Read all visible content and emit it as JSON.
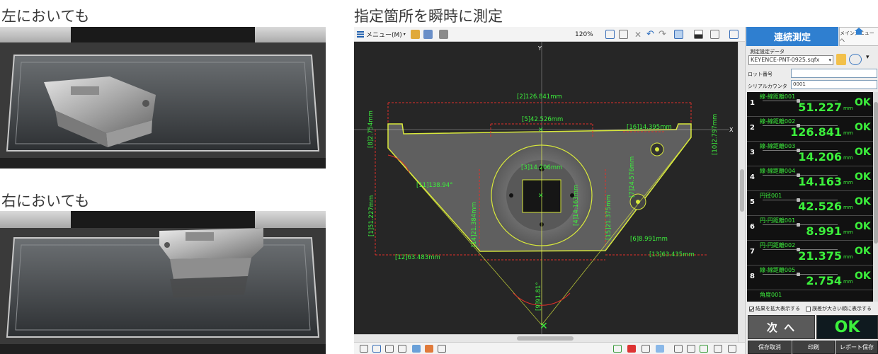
{
  "headings": {
    "left": "左においても",
    "right": "右においても",
    "main": "指定箇所を瞬時に測定"
  },
  "toolbar": {
    "menu_label": "メニュー(M)",
    "zoom": "120%",
    "axis_x": "X",
    "axis_y": "Y"
  },
  "annotations": [
    {
      "label": "[2]126.841mm"
    },
    {
      "label": "[5]42.526mm"
    },
    {
      "label": "[16]14.395mm"
    },
    {
      "label": "[8]2.754mm"
    },
    {
      "label": "[10]2.797mm"
    },
    {
      "label": "[3]14.206mm"
    },
    {
      "label": "[11]138.94°"
    },
    {
      "label": "[1]51.227mm"
    },
    {
      "label": "[14]21.384mm"
    },
    {
      "label": "[4]14.163mm"
    },
    {
      "label": "[15]21.375mm"
    },
    {
      "label": "[7]24.576mm"
    },
    {
      "label": "[6]8.991mm"
    },
    {
      "label": "[12]63.483mm"
    },
    {
      "label": "[13]63.435mm"
    },
    {
      "label": "[9]91.81°"
    }
  ],
  "panel": {
    "mode_title": "連続測定",
    "main_menu": "メインメニューへ",
    "setting_label": "測定設定データ",
    "setting_file": "KEYENCE-PNT-0925.sqfx",
    "lot_label": "ロット番号",
    "lot_value": "",
    "serial_label": "シリアルカウンタ",
    "serial_value": "0001",
    "unit": "mm",
    "results": [
      {
        "index": "1",
        "name": "線-線距離001",
        "value": "51.227",
        "judge": "OK"
      },
      {
        "index": "2",
        "name": "線-線距離002",
        "value": "126.841",
        "judge": "OK"
      },
      {
        "index": "3",
        "name": "線-線距離003",
        "value": "14.206",
        "judge": "OK"
      },
      {
        "index": "4",
        "name": "線-線距離004",
        "value": "14.163",
        "judge": "OK"
      },
      {
        "index": "5",
        "name": "円径001",
        "value": "42.526",
        "judge": "OK"
      },
      {
        "index": "6",
        "name": "円-円距離001",
        "value": "8.991",
        "judge": "OK"
      },
      {
        "index": "7",
        "name": "円-円距離002",
        "value": "21.375",
        "judge": "OK"
      },
      {
        "index": "8",
        "name": "線-線距離005",
        "value": "2.754",
        "judge": "OK"
      },
      {
        "index": "",
        "name": "角度001",
        "value": "",
        "judge": ""
      }
    ],
    "option_enlarge": "結果を拡大表示する",
    "option_sort": "誤差が大きい順に表示する",
    "next_button": "次 へ",
    "overall_judge": "OK",
    "btn_cancel": "保存取消",
    "btn_print": "印刷",
    "btn_report": "レポート保存"
  },
  "colors": {
    "measure_green": "#3cf03c",
    "dim_red": "#e0302a",
    "edge_yellow": "#d8e83c",
    "panel_blue": "#2f7fd0"
  }
}
